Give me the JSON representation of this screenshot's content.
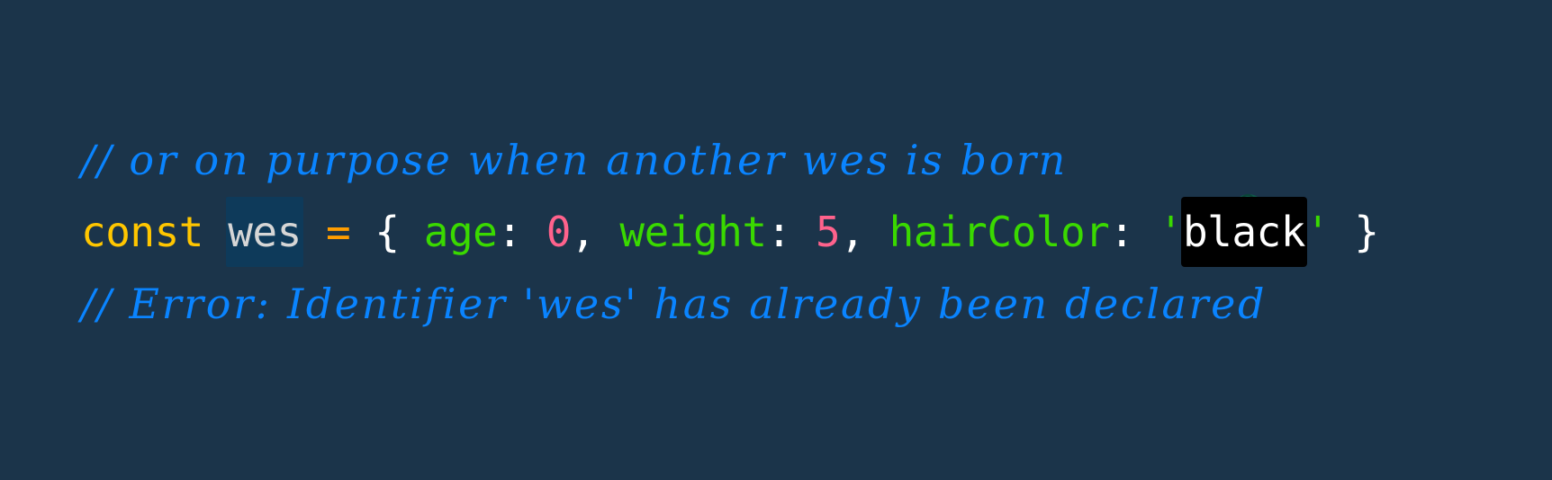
{
  "editor": {
    "background": "#1b344a",
    "lines": {
      "line1": {
        "comment": "// or on purpose when another wes is born",
        "icon": "baby-emoji-icon"
      },
      "line2": {
        "keyword": "const",
        "identifier": "wes",
        "operator": "=",
        "brace_open": "{",
        "prop1": "age",
        "colon1": ":",
        "val1": "0",
        "comma1": ",",
        "prop2": "weight",
        "colon2": ":",
        "val2": "5",
        "comma2": ",",
        "prop3": "hairColor",
        "colon3": ":",
        "quote_open": "'",
        "string_value": "black",
        "quote_close": "'",
        "brace_close": "}"
      },
      "line3": {
        "comment": "// Error: Identifier 'wes' has already been declared"
      }
    },
    "colors": {
      "comment": "#0a84ff",
      "keyword": "#ffc600",
      "operator": "#ff9d00",
      "property": "#3ad900",
      "number": "#ff628c",
      "selection": "#000000",
      "identifier_highlight": "#0e3a5a"
    }
  }
}
